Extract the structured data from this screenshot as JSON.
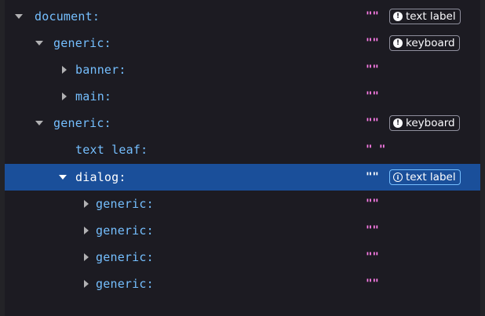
{
  "tree": {
    "rows": [
      {
        "role": "document:",
        "name": "\"\"",
        "badge": "text label",
        "expanded": true
      },
      {
        "role": "generic:",
        "name": "\"\"",
        "badge": "keyboard",
        "expanded": true
      },
      {
        "role": "banner:",
        "name": "\"\"",
        "expanded": false
      },
      {
        "role": "main:",
        "name": "\"\"",
        "expanded": false
      },
      {
        "role": "generic:",
        "name": "\"\"",
        "badge": "keyboard",
        "expanded": true
      },
      {
        "role": "text leaf:",
        "name": "\" \""
      },
      {
        "role": "dialog:",
        "name": "\"\"",
        "badge": "text label",
        "expanded": true,
        "selected": true
      },
      {
        "role": "generic:",
        "name": "\"\"",
        "expanded": false
      },
      {
        "role": "generic:",
        "name": "\"\"",
        "expanded": false
      },
      {
        "role": "generic:",
        "name": "\"\"",
        "expanded": false
      },
      {
        "role": "generic:",
        "name": "\"\"",
        "expanded": false
      }
    ]
  },
  "badges": {
    "warning_icon": "exclamation-circle-icon",
    "info_icon": "info-circle-icon"
  },
  "colors": {
    "background": "#1c1b22",
    "role_text": "#75bfff",
    "name_text": "#ff7de9",
    "selection": "#1a4f9a"
  }
}
